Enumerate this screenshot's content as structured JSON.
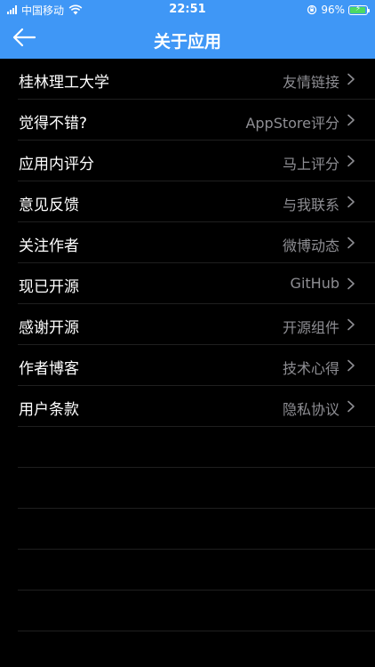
{
  "status_bar": {
    "carrier": "中国移动",
    "time": "22:51",
    "battery_percent": "96%",
    "battery_level": 0.96,
    "battery_color": "#4cd964"
  },
  "nav": {
    "title": "关于应用",
    "back_icon": "arrow-left-icon",
    "background_color": "#3f97f6"
  },
  "rows": [
    {
      "label": "桂林理工大学",
      "detail": "友情链接"
    },
    {
      "label": "觉得不错?",
      "detail": "AppStore评分"
    },
    {
      "label": "应用内评分",
      "detail": "马上评分"
    },
    {
      "label": "意见反馈",
      "detail": "与我联系"
    },
    {
      "label": "关注作者",
      "detail": "微博动态"
    },
    {
      "label": "现已开源",
      "detail": "GitHub"
    },
    {
      "label": "感谢开源",
      "detail": "开源组件"
    },
    {
      "label": "作者博客",
      "detail": "技术心得"
    },
    {
      "label": "用户条款",
      "detail": "隐私协议"
    }
  ]
}
